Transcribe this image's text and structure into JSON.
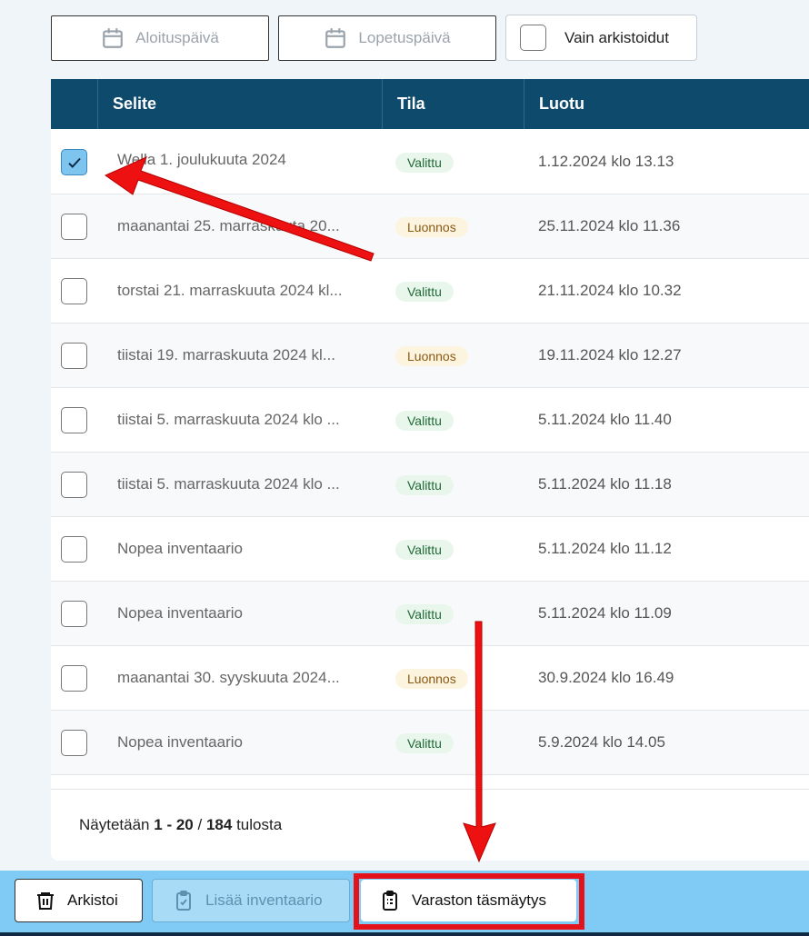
{
  "filters": {
    "start_date": {
      "label": "Aloituspäivä",
      "icon": "calendar-icon"
    },
    "end_date": {
      "label": "Lopetuspäivä",
      "icon": "calendar-icon"
    },
    "archived_only": {
      "label": "Vain arkistoidut",
      "checked": false
    }
  },
  "table": {
    "columns": [
      "Selite",
      "Tila",
      "Luotu"
    ],
    "rows": [
      {
        "checked": true,
        "description": "Wella 1. joulukuuta 2024",
        "status": "Valittu",
        "created": "1.12.2024 klo 13.13"
      },
      {
        "checked": false,
        "description": "maanantai 25. marraskuuta 20...",
        "status": "Luonnos",
        "created": "25.11.2024 klo 11.36"
      },
      {
        "checked": false,
        "description": "torstai 21. marraskuuta 2024 kl...",
        "status": "Valittu",
        "created": "21.11.2024 klo 10.32"
      },
      {
        "checked": false,
        "description": "tiistai 19. marraskuuta 2024 kl...",
        "status": "Luonnos",
        "created": "19.11.2024 klo 12.27"
      },
      {
        "checked": false,
        "description": "tiistai 5. marraskuuta 2024 klo ...",
        "status": "Valittu",
        "created": "5.11.2024 klo 11.40"
      },
      {
        "checked": false,
        "description": "tiistai 5. marraskuuta 2024 klo ...",
        "status": "Valittu",
        "created": "5.11.2024 klo 11.18"
      },
      {
        "checked": false,
        "description": "Nopea inventaario",
        "status": "Valittu",
        "created": "5.11.2024 klo 11.12"
      },
      {
        "checked": false,
        "description": "Nopea inventaario",
        "status": "Valittu",
        "created": "5.11.2024 klo 11.09"
      },
      {
        "checked": false,
        "description": "maanantai 30. syyskuuta 2024...",
        "status": "Luonnos",
        "created": "30.9.2024 klo 16.49"
      },
      {
        "checked": false,
        "description": "Nopea inventaario",
        "status": "Valittu",
        "created": "5.9.2024 klo 14.05"
      }
    ],
    "footer": {
      "prefix": "Näytetään",
      "from": "1",
      "dash": "-",
      "to": "20",
      "slash": "/",
      "total": "184",
      "suffix": "tulosta"
    }
  },
  "actions": {
    "archive": {
      "label": "Arkistoi",
      "icon": "trash-icon"
    },
    "add_inventory": {
      "label": "Lisää inventaario",
      "icon": "clipboard-check-icon",
      "disabled": true
    },
    "reconcile": {
      "label": "Varaston täsmäytys",
      "icon": "clipboard-list-icon",
      "highlighted": true
    }
  },
  "colors": {
    "header": "#0e4a6c",
    "action_bar": "#7fcbf5",
    "annotation": "#e3121b",
    "status_valittu_bg": "#e9f6ec",
    "status_luonnos_bg": "#fdf4e0"
  }
}
